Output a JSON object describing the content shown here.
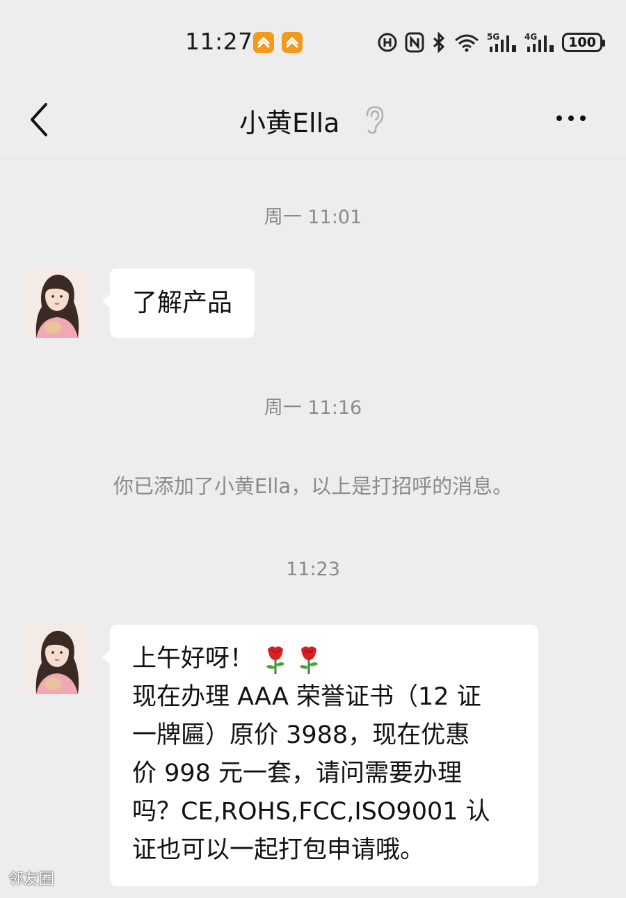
{
  "status_bar": {
    "time": "11:27",
    "battery": "100",
    "network_1": "5G",
    "network_2": "4G",
    "icons": [
      "notification-app-icon",
      "notification-app-icon",
      "hd-call-icon",
      "nfc-icon",
      "bluetooth-icon",
      "wifi-icon",
      "signal-5g-icon",
      "signal-4g-icon",
      "battery-icon"
    ]
  },
  "nav": {
    "title": "小黄Ella",
    "back_icon": "chevron-left-icon",
    "earpiece_icon": "ear-icon",
    "more_icon": "more-dots-icon"
  },
  "chat": {
    "time_1": "周一 11:01",
    "message_1": "了解产品",
    "time_2": "周一 11:16",
    "system_message": "你已添加了小黄Ella，以上是打招呼的消息。",
    "time_3": "11:23",
    "message_2_lines": [
      "上午好呀！",
      "现在办理 AAA 荣誉证书（12 证",
      "一牌匾）原价 3988，现在优惠",
      "价 998 元一套，请问需要办理",
      "吗？CE,ROHS,FCC,ISO9001 认",
      "证也可以一起打包申请哦。"
    ],
    "message_2_emoji": "rose-icon"
  },
  "watermark": "邻友圈",
  "colors": {
    "background": "#ededed",
    "bubble": "#ffffff",
    "muted_text": "#8a8a8a",
    "badge": "#f39a1c"
  }
}
